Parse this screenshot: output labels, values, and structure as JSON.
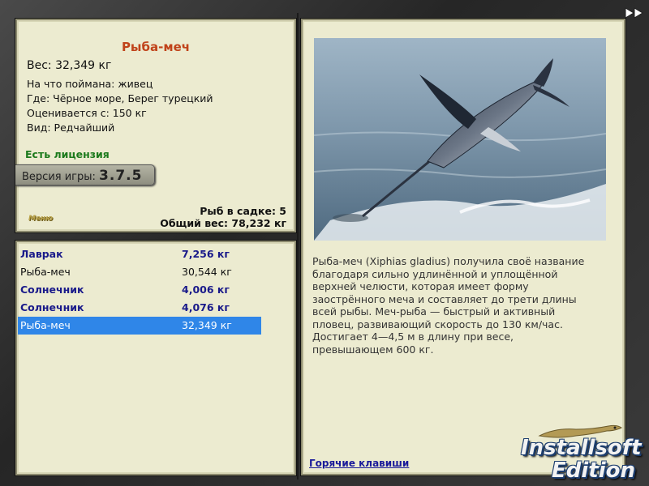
{
  "fish_card": {
    "title": "Рыба-меч",
    "weight": "Вес: 32,349 кг",
    "details": [
      "На что поймана: живец",
      "Где: Чёрное море, Берег турецкий",
      "Оценивается с: 150 кг",
      "Вид: Редчайший"
    ],
    "license": "Есть лицензия",
    "version_label": "Версия игры:",
    "version_value": "3.7.5",
    "menu_label": "Меню",
    "fish_count": "Рыб в садке: 5",
    "total_weight": "Общий вес: 78,232 кг"
  },
  "catch_list": [
    {
      "name": "Лаврак",
      "weight": "7,256 кг",
      "style": "bold"
    },
    {
      "name": "Рыба-меч",
      "weight": "30,544 кг",
      "style": "norm"
    },
    {
      "name": "Солнечник",
      "weight": "4,006 кг",
      "style": "bold"
    },
    {
      "name": "Солнечник",
      "weight": "4,076 кг",
      "style": "bold"
    },
    {
      "name": "Рыба-меч",
      "weight": "32,349 кг",
      "style": "sel"
    }
  ],
  "description": {
    "text": "Рыба-меч (Xiphias gladius) получила своё название благодаря сильно удлинённой и уплощённой верхней челюсти, которая имеет форму заострённого меча и составляет до трети длины всей рыбы. Меч-рыба — быстрый и активный пловец, развивающий скорость до 130 км/час. Достигает 4—4,5 м в длину при весе, превышающем 600 кг.",
    "hotkeys_link": "Горячие клавиши"
  },
  "watermark": {
    "line1": "Installsoft",
    "line2": "Edition"
  },
  "icons": {
    "fast_forward": "fast-forward-icon"
  },
  "colors": {
    "title": "#c0431a",
    "license": "#1c7a1c",
    "selected_row": "#2f86e8",
    "bold_row": "#1a1a8a",
    "link": "#1a1a9a"
  }
}
